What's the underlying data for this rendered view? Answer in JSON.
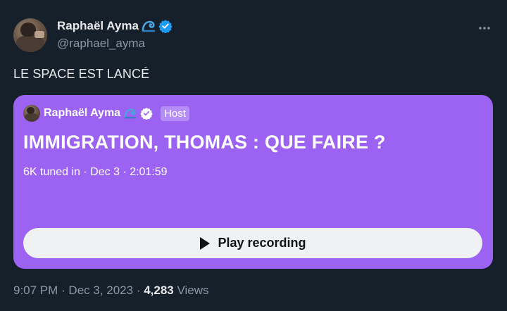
{
  "author": {
    "display_name": "Raphaël Ayma",
    "handle": "@raphael_ayma",
    "emoji_icon": "water-wave-icon",
    "verified_icon": "verified-badge-icon"
  },
  "tweet": {
    "text": "LE SPACE EST LANCÉ"
  },
  "space": {
    "host_name": "Raphaël Ayma",
    "host_badge": "Host",
    "title": "IMMIGRATION, THOMAS : QUE FAIRE ?",
    "meta": "6K tuned in · Dec 3 · 2:01:59",
    "play_label": "Play recording",
    "background_color": "#9c63f2"
  },
  "footer": {
    "time_date": "9:07 PM · Dec 3, 2023 · ",
    "views_count": "4,283",
    "views_label": " Views"
  },
  "colors": {
    "background": "#15202b",
    "verified": "#1d9bf0",
    "secondary_text": "#8b98a5"
  }
}
